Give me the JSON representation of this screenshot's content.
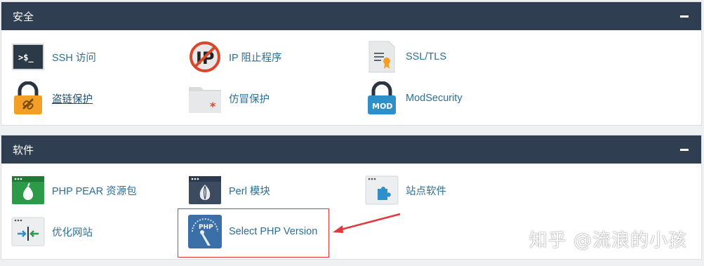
{
  "security": {
    "title": "安全",
    "items": [
      {
        "label": "SSH 访问",
        "icon": "terminal-icon"
      },
      {
        "label": "IP 阻止程序",
        "icon": "ip-blocker-icon"
      },
      {
        "label": "SSL/TLS",
        "icon": "certificate-icon"
      },
      {
        "label": "盗链保护",
        "icon": "padlock-link-icon"
      },
      {
        "label": "仿冒保护",
        "icon": "folder-asterisk-icon"
      },
      {
        "label": "ModSecurity",
        "icon": "padlock-mod-icon"
      }
    ],
    "terminal_text": ">$_",
    "mod_text": "MOD"
  },
  "software": {
    "title": "软件",
    "items": [
      {
        "label": "PHP PEAR 资源包",
        "icon": "php-pear-icon"
      },
      {
        "label": "Perl 模块",
        "icon": "perl-onion-icon"
      },
      {
        "label": "站点软件",
        "icon": "puzzle-icon"
      },
      {
        "label": "优化网站",
        "icon": "optimize-arrows-icon"
      },
      {
        "label": "Select PHP Version",
        "icon": "php-version-gauge-icon"
      }
    ],
    "php_gauge_text": "PHP"
  },
  "watermark": "知乎 @流浪的小孩",
  "colors": {
    "header_bg": "#2f3f51",
    "link": "#2d6e94",
    "highlight": "#e1383c"
  }
}
